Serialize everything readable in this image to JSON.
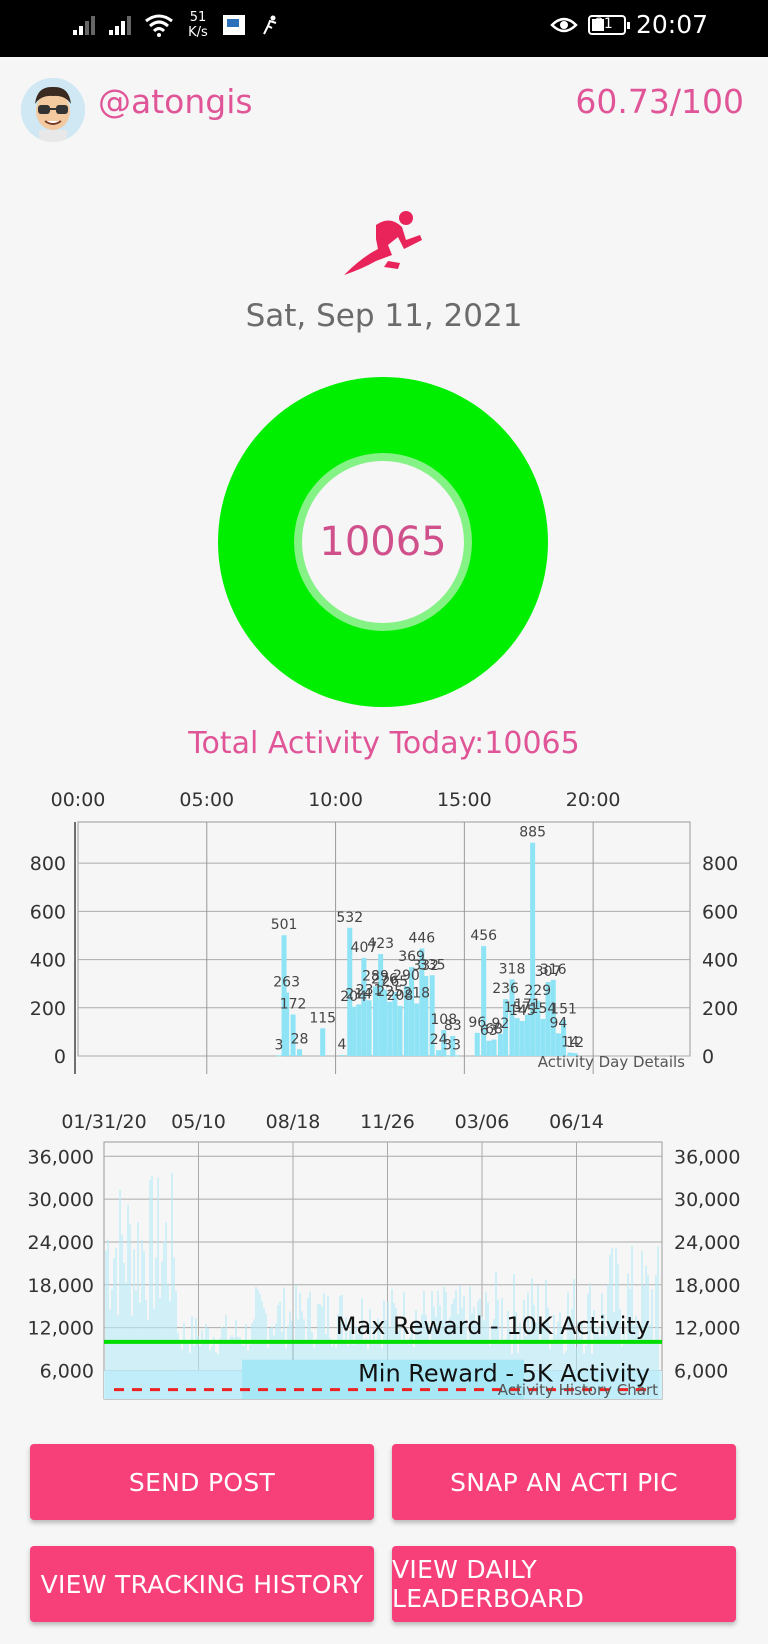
{
  "status_bar": {
    "net_speed_value": "51",
    "net_speed_unit": "K/s",
    "battery": "31",
    "time": "20:07"
  },
  "header": {
    "username": "@atongis",
    "score": "60.73/100"
  },
  "date": "Sat, Sep 11, 2021",
  "ring": {
    "value": "10065"
  },
  "total_activity": "Total Activity Today:10065",
  "colors": {
    "accent": "#e05598",
    "button": "#f73f7a",
    "ring": "#00ee00",
    "bar": "#8ee3f5",
    "max_line": "#00dd00",
    "min_line": "#ee2222"
  },
  "icons": [
    "runner-icon",
    "eye-icon",
    "battery-icon",
    "wifi-icon",
    "signal-icon"
  ],
  "buttons": {
    "send_post": "SEND POST",
    "snap_pic": "SNAP AN ACTI PIC",
    "view_history": "VIEW TRACKING HISTORY",
    "view_leaderboard": "VIEW DAILY LEADERBOARD"
  },
  "chart_data": [
    {
      "type": "bar",
      "caption": "Activity Day Details",
      "x_tick_labels": [
        "00:00",
        "05:00",
        "10:00",
        "15:00",
        "20:00"
      ],
      "x_ticks_hours": [
        0,
        5,
        10,
        15,
        20
      ],
      "xlim_hours": [
        0,
        24
      ],
      "ylim": [
        0,
        1000
      ],
      "y_ticks": [
        0,
        200,
        400,
        600,
        800
      ],
      "bars": [
        {
          "hour": 7.8,
          "value": 3
        },
        {
          "hour": 8.0,
          "value": 501
        },
        {
          "hour": 8.1,
          "value": 263
        },
        {
          "hour": 8.35,
          "value": 172
        },
        {
          "hour": 8.6,
          "value": 28
        },
        {
          "hour": 9.5,
          "value": 115
        },
        {
          "hour": 10.25,
          "value": 4
        },
        {
          "hour": 10.55,
          "value": 532
        },
        {
          "hour": 10.7,
          "value": 204
        },
        {
          "hour": 10.9,
          "value": 214
        },
        {
          "hour": 11.1,
          "value": 407
        },
        {
          "hour": 11.3,
          "value": 231
        },
        {
          "hour": 11.55,
          "value": 289
        },
        {
          "hour": 11.75,
          "value": 423
        },
        {
          "hour": 11.9,
          "value": 276
        },
        {
          "hour": 12.1,
          "value": 225
        },
        {
          "hour": 12.3,
          "value": 265
        },
        {
          "hour": 12.5,
          "value": 208
        },
        {
          "hour": 12.75,
          "value": 290
        },
        {
          "hour": 12.95,
          "value": 369
        },
        {
          "hour": 13.15,
          "value": 218
        },
        {
          "hour": 13.35,
          "value": 446
        },
        {
          "hour": 13.5,
          "value": 332
        },
        {
          "hour": 13.75,
          "value": 335
        },
        {
          "hour": 14.0,
          "value": 24
        },
        {
          "hour": 14.2,
          "value": 108
        },
        {
          "hour": 14.35,
          "value": 3
        },
        {
          "hour": 14.55,
          "value": 83
        },
        {
          "hour": 14.7,
          "value": 3
        },
        {
          "hour": 15.5,
          "value": 96
        },
        {
          "hour": 15.75,
          "value": 456
        },
        {
          "hour": 15.95,
          "value": 63
        },
        {
          "hour": 16.15,
          "value": 68
        },
        {
          "hour": 16.4,
          "value": 92
        },
        {
          "hour": 16.6,
          "value": 236
        },
        {
          "hour": 16.85,
          "value": 318
        },
        {
          "hour": 17.05,
          "value": 157
        },
        {
          "hour": 17.25,
          "value": 145
        },
        {
          "hour": 17.45,
          "value": 171
        },
        {
          "hour": 17.65,
          "value": 885
        },
        {
          "hour": 17.85,
          "value": 229
        },
        {
          "hour": 18.05,
          "value": 154
        },
        {
          "hour": 18.25,
          "value": 307
        },
        {
          "hour": 18.45,
          "value": 316
        },
        {
          "hour": 18.65,
          "value": 94
        },
        {
          "hour": 18.85,
          "value": 151
        },
        {
          "hour": 19.1,
          "value": 14
        },
        {
          "hour": 19.3,
          "value": 12
        }
      ]
    },
    {
      "type": "area",
      "caption": "Activity History Chart",
      "x_tick_labels": [
        "01/31/20",
        "05/10",
        "08/18",
        "11/26",
        "03/06",
        "06/14"
      ],
      "y_tick_labels": [
        "36,000",
        "30,000",
        "24,000",
        "18,000",
        "12,000",
        "6,000"
      ],
      "y_ticks": [
        36000,
        30000,
        24000,
        18000,
        12000,
        6000
      ],
      "ylim": [
        2000,
        38000
      ],
      "reference_lines": [
        {
          "label": "Max Reward - 10K Activity",
          "value": 10000,
          "style": "solid"
        },
        {
          "label": "Min Reward - 5K Activity",
          "value": 5000,
          "style": "dashed"
        }
      ]
    }
  ]
}
